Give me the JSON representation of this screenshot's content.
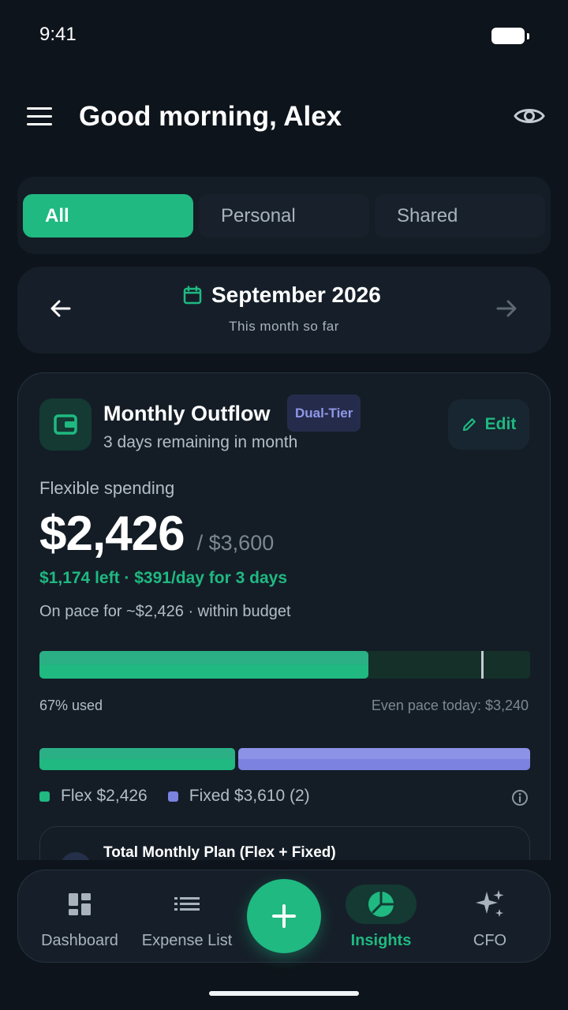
{
  "status_bar": {
    "time": "9:41"
  },
  "header": {
    "greeting": "Good morning, Alex"
  },
  "segments": [
    {
      "label": "All",
      "active": true
    },
    {
      "label": "Personal",
      "active": false
    },
    {
      "label": "Shared",
      "active": false
    }
  ],
  "month": {
    "label": "September 2026",
    "subtitle": "This month so far"
  },
  "outflow": {
    "title": "Monthly Outflow",
    "badge": "Dual-Tier",
    "subtitle": "3 days remaining in month",
    "edit_label": "Edit",
    "flex_label": "Flexible spending",
    "amount": "$2,426",
    "budget": "/ $3,600",
    "left_line": "$1,174 left · $391/day for 3 days",
    "pace_line": "On pace for ~$2,426 · within budget",
    "progress_fraction": 0.67,
    "even_pace_fraction": 0.9,
    "used_label": "67% used",
    "even_pace_label": "Even pace today: $3,240",
    "split": {
      "flex_value": 2426,
      "fixed_value": 3610
    },
    "legend": {
      "flex": "Flex $2,426",
      "fixed": "Fixed $3,610 (2)"
    },
    "plan_title": "Total Monthly Plan (Flex + Fixed)"
  },
  "colors": {
    "accent": "#1fb981",
    "fixed": "#7b82e0",
    "background": "#0e141b"
  },
  "nav": [
    {
      "label": "Dashboard",
      "icon": "dashboard-icon",
      "active": false
    },
    {
      "label": "Expense List",
      "icon": "list-icon",
      "active": false
    },
    {
      "label": "Insights",
      "icon": "pie-chart-icon",
      "active": true
    },
    {
      "label": "CFO",
      "icon": "sparkles-icon",
      "active": false
    }
  ],
  "fab": {
    "icon": "plus-icon"
  }
}
